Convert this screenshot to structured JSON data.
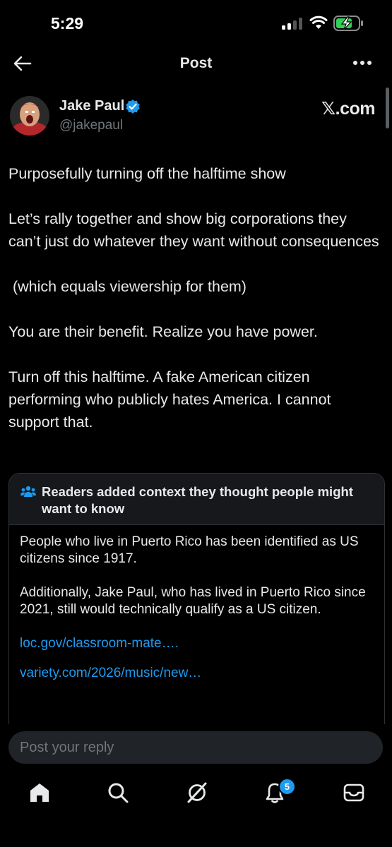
{
  "status_bar": {
    "time": "5:29"
  },
  "header": {
    "title": "Post"
  },
  "author": {
    "name": "Jake Paul",
    "handle": "@jakepaul"
  },
  "source_badge": "𝕏.com",
  "post": {
    "paragraphs": [
      "Purposefully turning off the halftime show",
      "Let’s rally together and show big corporations they can’t just do whatever they want without consequences",
      " (which equals viewership for them)",
      "You are their benefit. Realize you have power.",
      "Turn off this halftime. A fake American citizen performing who publicly hates America. I cannot support that."
    ]
  },
  "community_note": {
    "title": "Readers added context they thought people might want to know",
    "paragraphs": [
      "People who live in Puerto Rico has been identified as US citizens since 1917.",
      "Additionally, Jake Paul, who has lived in Puerto Rico since 2021, still would technically qualify as a US citizen."
    ],
    "links": [
      "loc.gov/classroom-mate….",
      "variety.com/2026/music/new…"
    ]
  },
  "reply": {
    "placeholder": "Post your reply"
  },
  "tab_bar": {
    "items": [
      "home-icon",
      "search-icon",
      "grok-icon",
      "notifications-icon",
      "messages-icon"
    ],
    "notification_count": "5"
  },
  "colors": {
    "accent": "#1d9bf0",
    "background": "#000000",
    "text": "#e7e9ea",
    "muted": "#71767b",
    "border": "#2f3336"
  }
}
